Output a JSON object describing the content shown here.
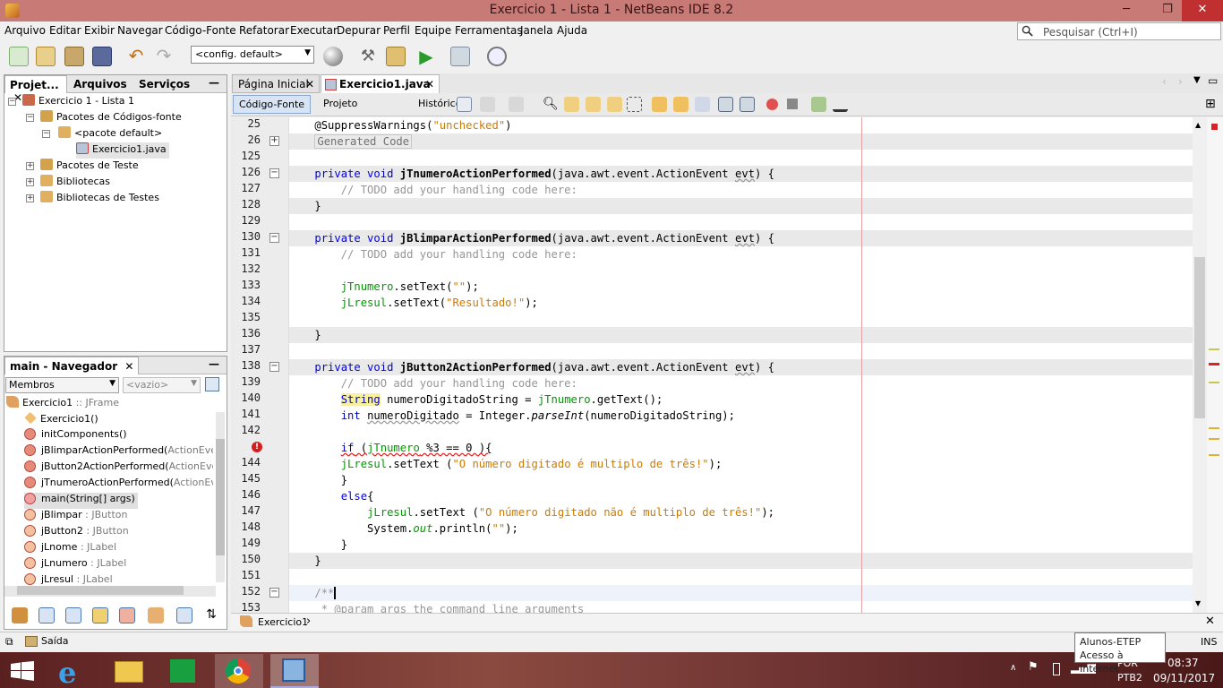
{
  "window": {
    "title": "Exercicio 1 - Lista 1 - NetBeans IDE 8.2",
    "minimize": "─",
    "restore": "❐",
    "close": "✕"
  },
  "menu": [
    "Arquivo",
    "Editar",
    "Exibir",
    "Navegar",
    "Código-Fonte",
    "Refatorar",
    "Executar",
    "Depurar",
    "Perfil",
    "Equipe",
    "Ferramentas",
    "Janela",
    "Ajuda"
  ],
  "search": {
    "placeholder": "Pesquisar (Ctrl+I)"
  },
  "toolbar": {
    "config": "<config. default>"
  },
  "projects": {
    "tabs": [
      "Projet...",
      "Arquivos",
      "Serviços"
    ],
    "tree": [
      "Exercicio 1 - Lista 1",
      "Pacotes de Códigos-fonte",
      "<pacote default>",
      "Exercicio1.java",
      "Pacotes de Teste",
      "Bibliotecas",
      "Bibliotecas de Testes"
    ]
  },
  "navigator": {
    "title": "main - Navegador",
    "filter": "Membros",
    "empty": "<vazio>",
    "root": {
      "name": "Exercicio1",
      "type": " :: JFrame"
    },
    "items": [
      {
        "name": "Exercicio1()",
        "type": ""
      },
      {
        "name": "initComponents()",
        "type": ""
      },
      {
        "name": "jBlimparActionPerformed(",
        "type": "ActionEvent e"
      },
      {
        "name": "jButton2ActionPerformed(",
        "type": "ActionEvent e"
      },
      {
        "name": "jTnumeroActionPerformed(",
        "type": "ActionEvent"
      },
      {
        "name": "main(String[] args)",
        "type": ""
      },
      {
        "name": "jBlimpar",
        "type": " : JButton"
      },
      {
        "name": "jButton2",
        "type": " : JButton"
      },
      {
        "name": "jLnome",
        "type": " : JLabel"
      },
      {
        "name": "jLnumero",
        "type": " : JLabel"
      },
      {
        "name": "jLresul",
        "type": " : JLabel"
      }
    ]
  },
  "editor": {
    "tabs": [
      "Página Inicial",
      "Exercicio1.java"
    ],
    "modes": [
      "Código-Fonte",
      "Projeto",
      "Histórico"
    ],
    "line_numbers": [
      "25",
      "26",
      "125",
      "126",
      "127",
      "128",
      "129",
      "130",
      "131",
      "132",
      "133",
      "134",
      "135",
      "136",
      "137",
      "138",
      "139",
      "140",
      "141",
      "142",
      "",
      "144",
      "145",
      "146",
      "147",
      "148",
      "149",
      "150",
      "151",
      "152",
      "153"
    ]
  },
  "breadcrumb": "Exercicio1",
  "status": {
    "output": "Saída",
    "mode": "INS"
  },
  "tooltip": {
    "line1": "Alunos-ETEP",
    "line2": "Acesso à Internet"
  },
  "tray": {
    "lang1": "POR",
    "lang2": "PTB2",
    "time": "08:37",
    "date": "09/11/2017"
  }
}
